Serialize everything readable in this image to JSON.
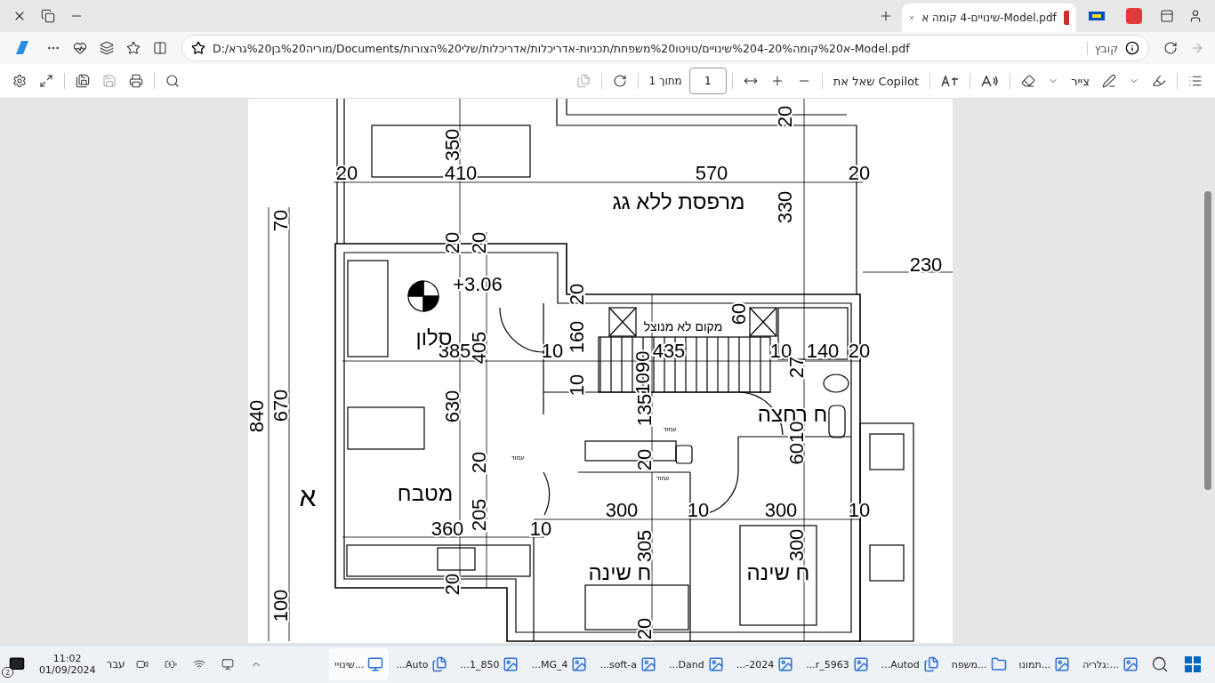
{
  "browser_tab": {
    "title": "שינויים-4 קומה א-Model.pdf",
    "selected": true
  },
  "address_bar": {
    "scheme_label": "קובץ",
    "url": "D:/מוריה%20בן%20גרא/Documents/א%20קומה%204-20%שינויים/טויטו%20משפחת/תכניות-אדריכלות/אדריכלות/שלי%20הצורות-Model.pdf"
  },
  "pdf_toolbar": {
    "ask_copilot": "שאל את Copilot",
    "draw": "צייר",
    "page_number": "1",
    "page_total": "מתוך 1"
  },
  "plan": {
    "labels": [
      {
        "text": "20",
        "kind": "dimension"
      },
      {
        "text": "350",
        "kind": "dimension"
      },
      {
        "text": "20",
        "kind": "dimension"
      },
      {
        "text": "570",
        "kind": "dimension"
      },
      {
        "text": "410",
        "kind": "dimension"
      },
      {
        "text": "20",
        "kind": "dimension"
      },
      {
        "text": "330",
        "kind": "dimension"
      },
      {
        "text": "מרפסת ללא גג",
        "kind": "room"
      },
      {
        "text": "70",
        "kind": "dimension"
      },
      {
        "text": "20",
        "kind": "dimension"
      },
      {
        "text": "20",
        "kind": "dimension"
      },
      {
        "text": "230",
        "kind": "dimension"
      },
      {
        "text": "+3.06",
        "kind": "dimension"
      },
      {
        "text": "20",
        "kind": "dimension"
      },
      {
        "text": "60",
        "kind": "dimension"
      },
      {
        "text": "מקום לא מנוצל",
        "kind": "note"
      },
      {
        "text": "20",
        "kind": "dimension"
      },
      {
        "text": "140",
        "kind": "dimension"
      },
      {
        "text": "10",
        "kind": "dimension"
      },
      {
        "text": "435",
        "kind": "dimension"
      },
      {
        "text": "160",
        "kind": "dimension"
      },
      {
        "text": "10",
        "kind": "dimension"
      },
      {
        "text": "405",
        "kind": "dimension"
      },
      {
        "text": "385",
        "kind": "dimension"
      },
      {
        "text": "סלון",
        "kind": "room"
      },
      {
        "text": "27",
        "kind": "dimension"
      },
      {
        "text": "1090",
        "kind": "dimension"
      },
      {
        "text": "10",
        "kind": "dimension"
      },
      {
        "text": "ח רחצה",
        "kind": "room"
      },
      {
        "text": "135",
        "kind": "dimension"
      },
      {
        "text": "630",
        "kind": "dimension"
      },
      {
        "text": "670",
        "kind": "dimension"
      },
      {
        "text": "840",
        "kind": "dimension"
      },
      {
        "text": "6010",
        "kind": "dimension"
      },
      {
        "text": "עמוד",
        "kind": "tag"
      },
      {
        "text": "20",
        "kind": "dimension"
      },
      {
        "text": "עמוד",
        "kind": "tag"
      },
      {
        "text": "20",
        "kind": "dimension"
      },
      {
        "text": "עמוד",
        "kind": "tag"
      },
      {
        "text": "מטבח",
        "kind": "room"
      },
      {
        "text": "א",
        "kind": "marker"
      },
      {
        "text": "10",
        "kind": "dimension"
      },
      {
        "text": "300",
        "kind": "dimension"
      },
      {
        "text": "10",
        "kind": "dimension"
      },
      {
        "text": "300",
        "kind": "dimension"
      },
      {
        "text": "205",
        "kind": "dimension"
      },
      {
        "text": "10",
        "kind": "dimension"
      },
      {
        "text": "360",
        "kind": "dimension"
      },
      {
        "text": "300",
        "kind": "dimension"
      },
      {
        "text": "305",
        "kind": "dimension"
      },
      {
        "text": "ח שינה",
        "kind": "room"
      },
      {
        "text": "ח שינה",
        "kind": "room"
      },
      {
        "text": "20",
        "kind": "dimension"
      },
      {
        "text": "100",
        "kind": "dimension"
      },
      {
        "text": "20",
        "kind": "dimension"
      }
    ]
  },
  "taskbar": {
    "apps": [
      {
        "label": "גלריה:...",
        "selected": false
      },
      {
        "label": "תמונו...",
        "selected": false
      },
      {
        "label": "משפח...",
        "selected": false
      },
      {
        "label": "...Autod",
        "selected": false
      },
      {
        "label": "...r_5963",
        "selected": false
      },
      {
        "label": "...-2024",
        "selected": false
      },
      {
        "label": "...Dand",
        "selected": false
      },
      {
        "label": "...soft-a",
        "selected": false
      },
      {
        "label": "...MG_4",
        "selected": false
      },
      {
        "label": "...1_850",
        "selected": false
      },
      {
        "label": "...Auto",
        "selected": false
      },
      {
        "label": "שינויי...",
        "selected": true
      }
    ],
    "weather": "עבר",
    "time": "11:02",
    "date": "01/09/2024",
    "notifications": "2"
  }
}
